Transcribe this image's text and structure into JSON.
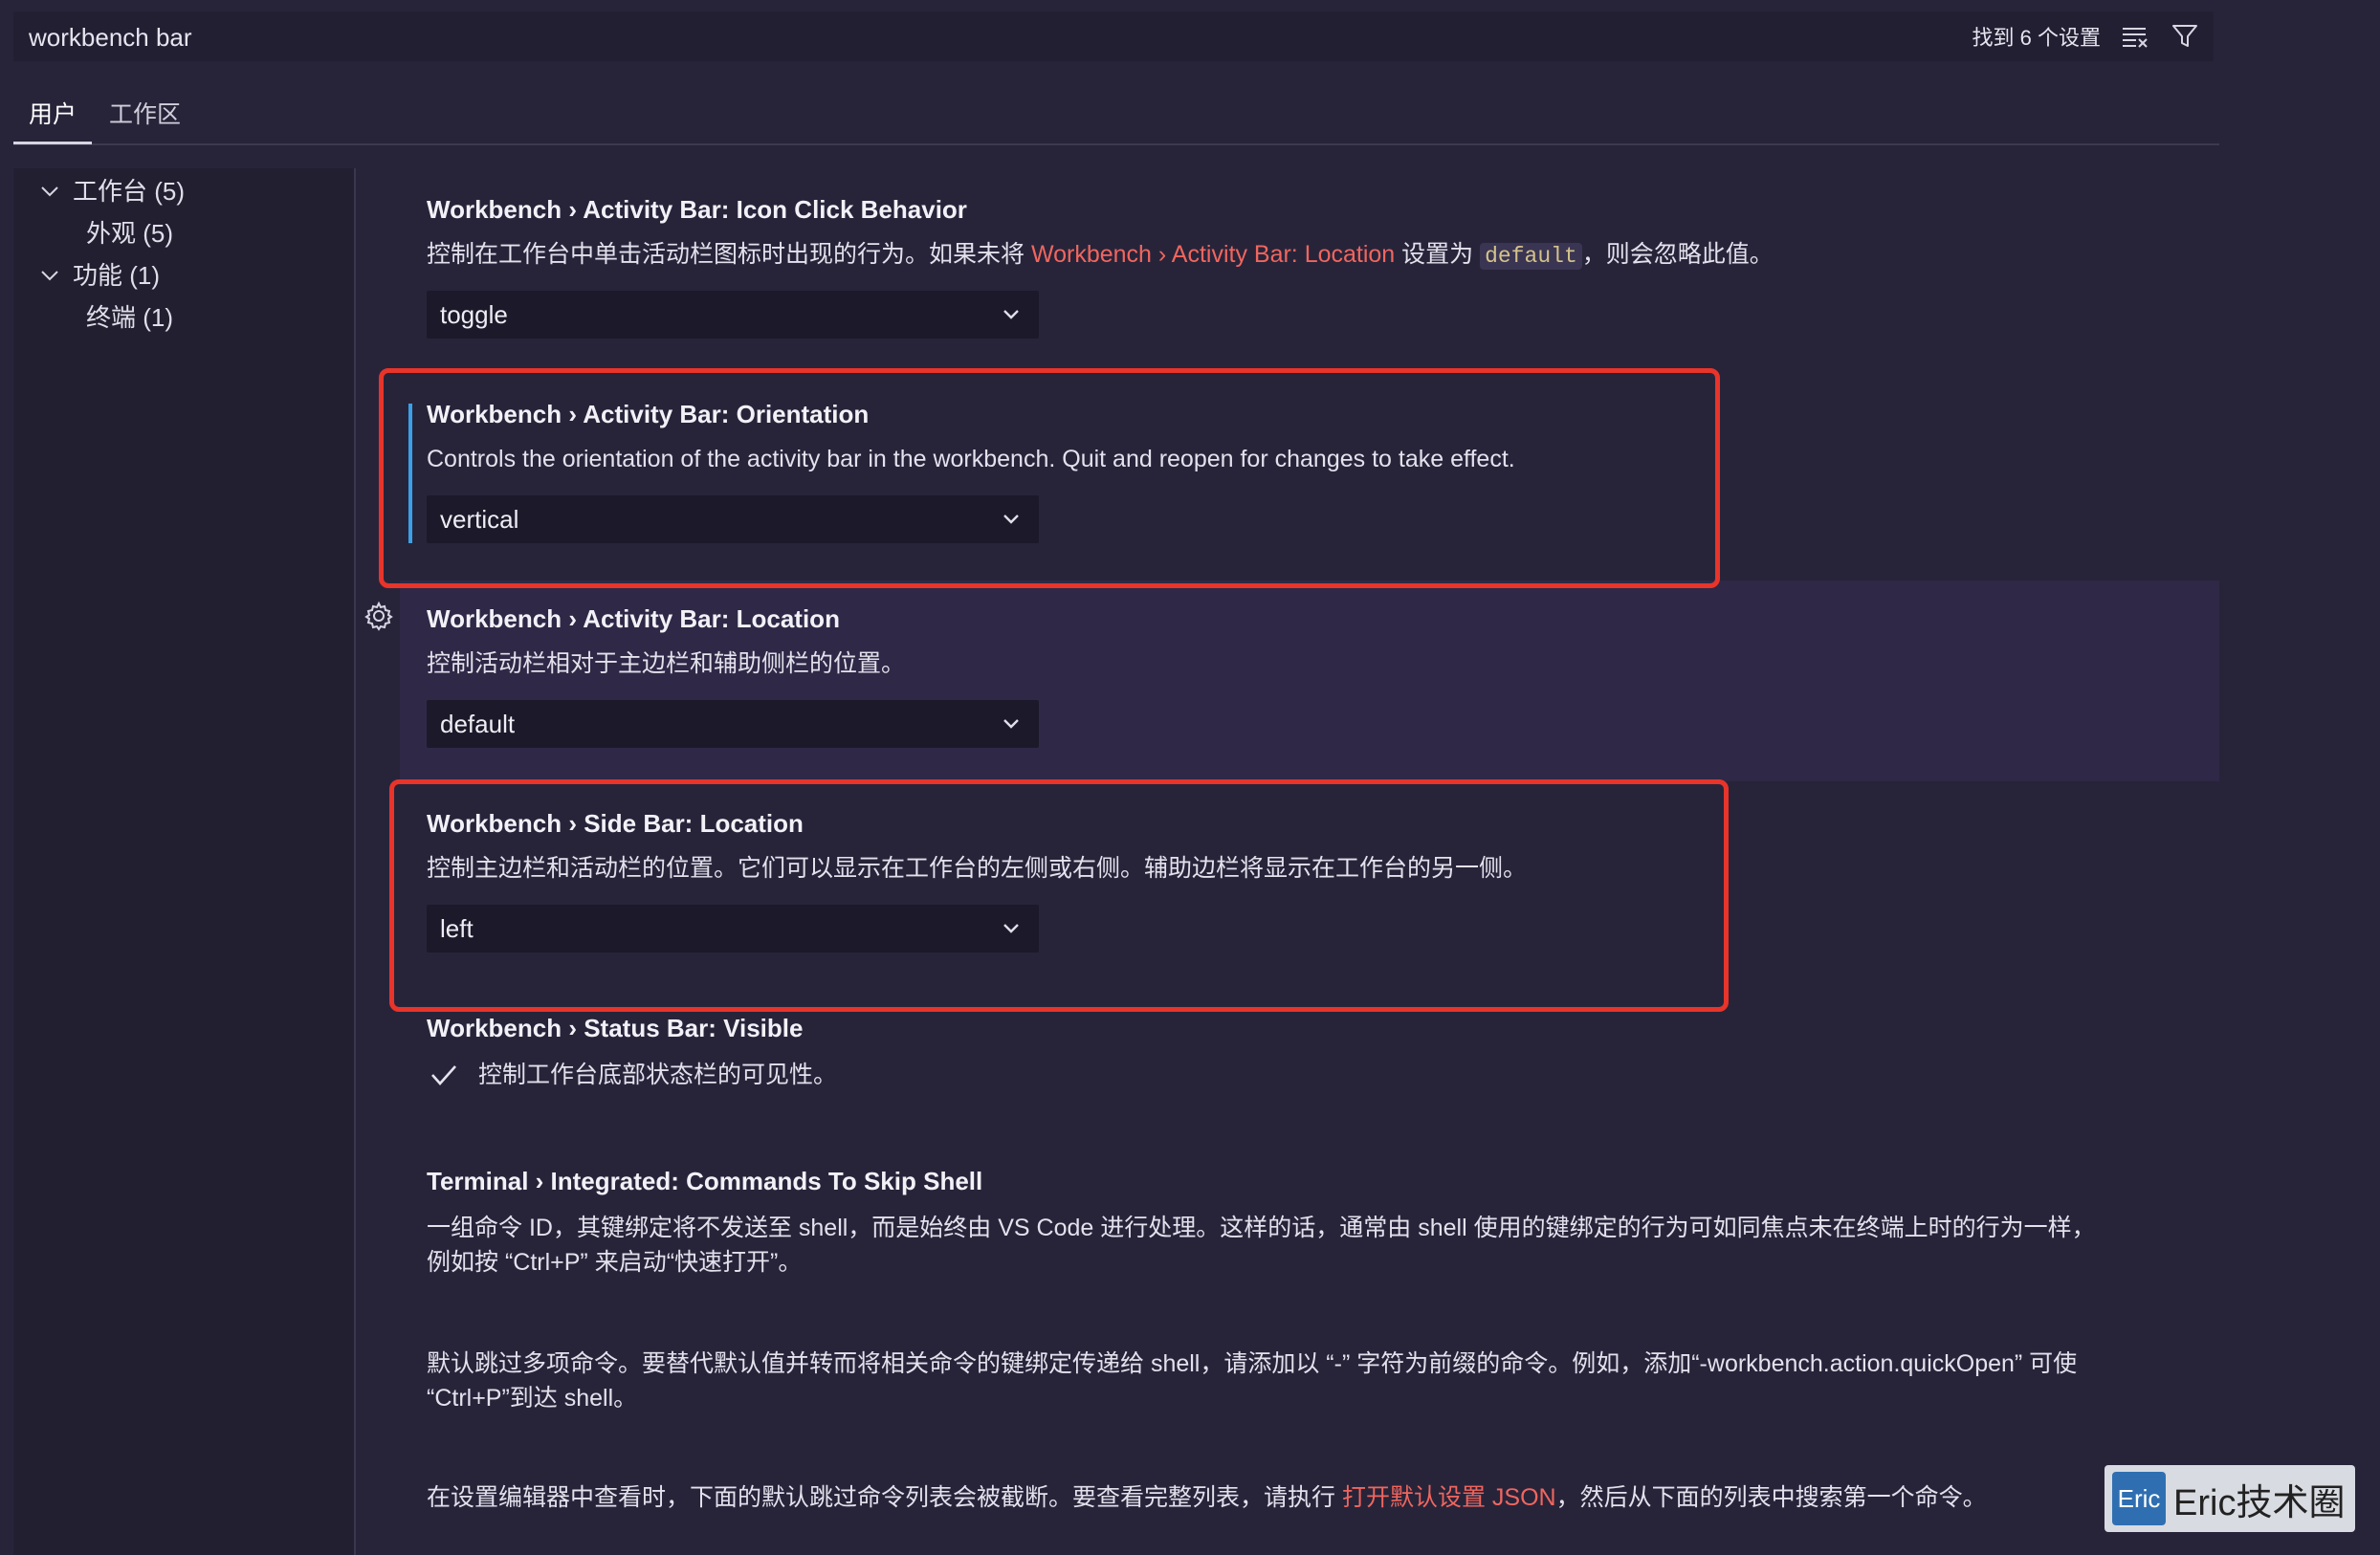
{
  "search": {
    "value": "workbench bar",
    "result_count": "找到 6 个设置"
  },
  "tabs": [
    {
      "label": "用户"
    },
    {
      "label": "工作区"
    }
  ],
  "tree": [
    {
      "label": "工作台 (5)"
    },
    {
      "label": "外观 (5)"
    },
    {
      "label": "功能 (1)"
    },
    {
      "label": "终端 (1)"
    }
  ],
  "settings": {
    "icon_click": {
      "title": "Workbench › Activity Bar: Icon Click Behavior",
      "desc_before": "控制在工作台中单击活动栏图标时出现的行为。如果未将 ",
      "desc_link": "Workbench › Activity Bar: Location",
      "desc_middle": " 设置为 ",
      "desc_code": "default",
      "desc_after": "，则会忽略此值。",
      "value": "toggle"
    },
    "orientation": {
      "title": "Workbench › Activity Bar: Orientation",
      "desc": "Controls the orientation of the activity bar in the workbench. Quit and reopen for changes to take effect.",
      "value": "vertical"
    },
    "activity_location": {
      "title": "Workbench › Activity Bar: Location",
      "desc": "控制活动栏相对于主边栏和辅助侧栏的位置。",
      "value": "default"
    },
    "side_bar_location": {
      "title": "Workbench › Side Bar: Location",
      "desc": "控制主边栏和活动栏的位置。它们可以显示在工作台的左侧或右侧。辅助边栏将显示在工作台的另一侧。",
      "value": "left"
    },
    "status_bar": {
      "title": "Workbench › Status Bar: Visible",
      "desc": "控制工作台底部状态栏的可见性。"
    },
    "skip_shell": {
      "title": "Terminal › Integrated: Commands To Skip Shell",
      "desc_line1": "一组命令 ID，其键绑定将不发送至 shell，而是始终由 VS Code 进行处理。这样的话，通常由 shell 使用的键绑定的行为可如同焦点未在终端上时的行为一样，",
      "desc_line2": "例如按 “Ctrl+P” 来启动“快速打开”。",
      "desc_line3": "默认跳过多项命令。要替代默认值并转而将相关命令的键绑定传递给 shell，请添加以 “-” 字符为前缀的命令。例如，添加“-workbench.action.quickOpen” 可使",
      "desc_line4": "“Ctrl+P”到达 shell。",
      "desc_line5_before": "在设置编辑器中查看时，下面的默认跳过命令列表会被截断。要查看完整列表，请执行 ",
      "desc_line5_link": "打开默认设置 JSON",
      "desc_line5_after": "，然后从下面的列表中搜索第一个命令。"
    }
  },
  "watermark": {
    "logo": "Eric",
    "text": "Eric技术圈"
  },
  "colors": {
    "background": "#27243a",
    "link": "#f0665e",
    "highlight_box": "#e8342a",
    "focus_bar": "#3aa0e8"
  }
}
